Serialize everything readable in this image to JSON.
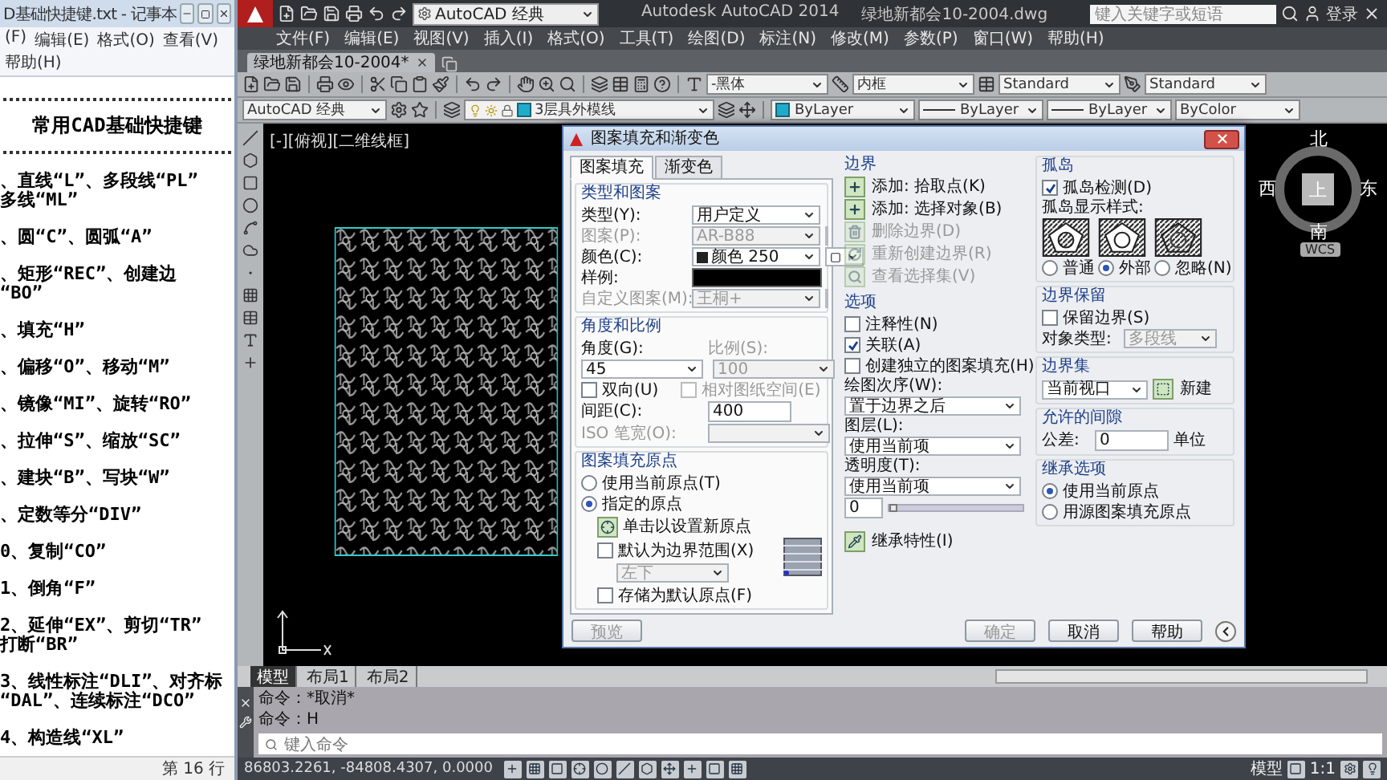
{
  "notepad": {
    "title": "D基础快捷键.txt - 记事本",
    "menu": [
      "(F)",
      "编辑(E)",
      "格式(O)",
      "查看(V)",
      "帮助(H)"
    ],
    "lines": [
      {
        "kind": "rule"
      },
      {
        "kind": "heading",
        "lines": [
          "常用CAD基础快捷键"
        ]
      },
      {
        "kind": "rule"
      },
      {
        "kind": "item",
        "lines": [
          "、直线“L”、多段线“PL”",
          "多线“ML”"
        ]
      },
      {
        "kind": "item",
        "lines": [
          "、圆“C”、圆弧“A”"
        ]
      },
      {
        "kind": "item",
        "lines": [
          "、矩形“REC”、创建边",
          "“BO”"
        ]
      },
      {
        "kind": "item",
        "lines": [
          "、填充“H”"
        ]
      },
      {
        "kind": "item",
        "lines": [
          "、偏移“O”、移动“M”"
        ]
      },
      {
        "kind": "item",
        "lines": [
          "、镜像“MI”、旋转“RO”"
        ]
      },
      {
        "kind": "item",
        "lines": [
          "、拉伸“S”、缩放“SC”"
        ]
      },
      {
        "kind": "item",
        "lines": [
          "、建块“B”、写块“W”"
        ]
      },
      {
        "kind": "item",
        "lines": [
          "、定数等分“DIV”"
        ]
      },
      {
        "kind": "item",
        "lines": [
          "0、复制“CO”"
        ]
      },
      {
        "kind": "item",
        "lines": [
          "1、倒角“F”"
        ]
      },
      {
        "kind": "item",
        "lines": [
          "2、延伸“EX”、剪切“TR”",
          "打断“BR”"
        ]
      },
      {
        "kind": "item",
        "lines": [
          "3、线性标注“DLI”、对齐标",
          "“DAL”、连续标注“DCO”"
        ]
      },
      {
        "kind": "item",
        "lines": [
          "4、构造线“XL”"
        ]
      }
    ],
    "status": "第 16 行"
  },
  "autocad": {
    "workspace": "AutoCAD 经典",
    "app_title": "Autodesk AutoCAD 2014",
    "file_title": "绿地新都会10-2004.dwg",
    "search_placeholder": "键入关键字或短语",
    "login": "登录",
    "menu": [
      "文件(F)",
      "编辑(E)",
      "视图(V)",
      "插入(I)",
      "格式(O)",
      "工具(T)",
      "绘图(D)",
      "标注(N)",
      "修改(M)",
      "参数(P)",
      "窗口(W)",
      "帮助(H)"
    ],
    "doc_tab": "绿地新都会10-2004*",
    "styles": [
      "-黑体",
      "内框",
      "Standard",
      "Standard"
    ],
    "workspace2": "AutoCAD 经典",
    "layer": "3层具外模线",
    "props": [
      "ByLayer",
      "ByLayer",
      "ByLayer",
      "ByColor"
    ],
    "viewport_label": "[-][俯视][二维线框]",
    "viewcube": {
      "north": "北",
      "west": "西",
      "east": "东",
      "south": "南",
      "top": "上",
      "wcs": "WCS"
    },
    "layout_tabs": [
      {
        "label": "模型",
        "selected": true
      },
      {
        "label": "布局1",
        "selected": false
      },
      {
        "label": "布局2",
        "selected": false
      }
    ],
    "command": {
      "history": [
        "命令：*取消*",
        "命令：H"
      ],
      "placeholder": "键入命令"
    },
    "status_bar": {
      "coords": "86803.2261, -84808.4307, 0.0000",
      "model": "模型",
      "scale": "1:1"
    }
  },
  "dialog": {
    "title": "图案填充和渐变色",
    "tabs": [
      {
        "label": "图案填充",
        "selected": true
      },
      {
        "label": "渐变色",
        "selected": false
      }
    ],
    "type_pattern": {
      "legend": "类型和图案",
      "rows": [
        {
          "kind": "select",
          "label": "类型(Y):",
          "value": "用户定义",
          "disabled": false
        },
        {
          "kind": "browse_select",
          "label": "图案(P):",
          "value": "AR-B88",
          "disabled": true
        },
        {
          "kind": "color",
          "label": "颜色(C):",
          "value": "颜色 250",
          "disabled": false
        },
        {
          "kind": "swatch",
          "label": "样例:",
          "disabled": false
        },
        {
          "kind": "browse_select",
          "label": "自定义图案(M):",
          "value": "王桐+",
          "disabled": true
        }
      ]
    },
    "angle_scale": {
      "legend": "角度和比例",
      "angle": {
        "label": "角度(G):",
        "value": "45",
        "disabled": false
      },
      "scale": {
        "label": "比例(S):",
        "value": "100",
        "disabled": true
      },
      "checks": [
        {
          "label": "双向(U)",
          "checked": false,
          "disabled": false
        },
        {
          "label": "相对图纸空间(E)",
          "checked": false,
          "disabled": true
        }
      ],
      "spacing": {
        "label": "间距(C):",
        "value": "400"
      },
      "iso": {
        "label": "ISO 笔宽(O):",
        "disabled": true
      }
    },
    "origin": {
      "legend": "图案填充原点",
      "radios": [
        {
          "label": "使用当前原点(T)",
          "selected": false
        },
        {
          "label": "指定的原点",
          "selected": true
        }
      ],
      "set_button": "单击以设置新原点",
      "checks": [
        {
          "label": "默认为边界范围(X)",
          "checked": false
        },
        {
          "label": "存储为默认原点(F)",
          "checked": false
        }
      ],
      "position": {
        "value": "左下",
        "disabled": true
      }
    },
    "preview": {
      "label": "预览",
      "disabled": true
    },
    "boundaries": {
      "legend": "边界",
      "buttons": [
        {
          "label": "添加: 拾取点(K)",
          "disabled": false
        },
        {
          "label": "添加: 选择对象(B)",
          "disabled": false
        },
        {
          "label": "删除边界(D)",
          "disabled": true
        },
        {
          "label": "重新创建边界(R)",
          "disabled": true
        },
        {
          "label": "查看选择集(V)",
          "disabled": true
        }
      ]
    },
    "options": {
      "legend": "选项",
      "checks": [
        {
          "label": "注释性(N)",
          "checked": false
        },
        {
          "label": "关联(A)",
          "checked": true
        },
        {
          "label": "创建独立的图案填充(H)",
          "checked": false
        }
      ],
      "selects": [
        {
          "label": "绘图次序(W):",
          "value": "置于边界之后"
        },
        {
          "label": "图层(L):",
          "value": "使用当前项"
        },
        {
          "label": "透明度(T):",
          "value": "使用当前项"
        }
      ],
      "transparency": {
        "value": "0",
        "level": 0
      }
    },
    "inherit": "继承特性(I)",
    "islands": {
      "legend": "孤岛",
      "detect": {
        "label": "孤岛检测(D)",
        "checked": true
      },
      "style_label": "孤岛显示样式:",
      "styles": [
        {
          "kind": "normal",
          "label": "普通",
          "selected": false
        },
        {
          "kind": "outer",
          "label": "外部",
          "selected": true
        },
        {
          "kind": "ignore",
          "label": "忽略(N)",
          "selected": false
        }
      ]
    },
    "retain": {
      "legend": "边界保留",
      "check": {
        "label": "保留边界(S)",
        "checked": false
      },
      "type_label": "对象类型:",
      "type_value": "多段线",
      "type_disabled": true
    },
    "boundary_set": {
      "legend": "边界集",
      "value": "当前视口",
      "new": "新建"
    },
    "gap": {
      "legend": "允许的间隙",
      "label": "公差:",
      "value": "0",
      "unit": "单位"
    },
    "inherit_options": {
      "legend": "继承选项",
      "radios": [
        {
          "label": "使用当前原点",
          "selected": true
        },
        {
          "label": "用源图案填充原点",
          "selected": false
        }
      ]
    },
    "buttons": [
      {
        "label": "确定",
        "disabled": true
      },
      {
        "label": "取消",
        "disabled": false
      },
      {
        "label": "帮助",
        "disabled": false
      }
    ]
  }
}
